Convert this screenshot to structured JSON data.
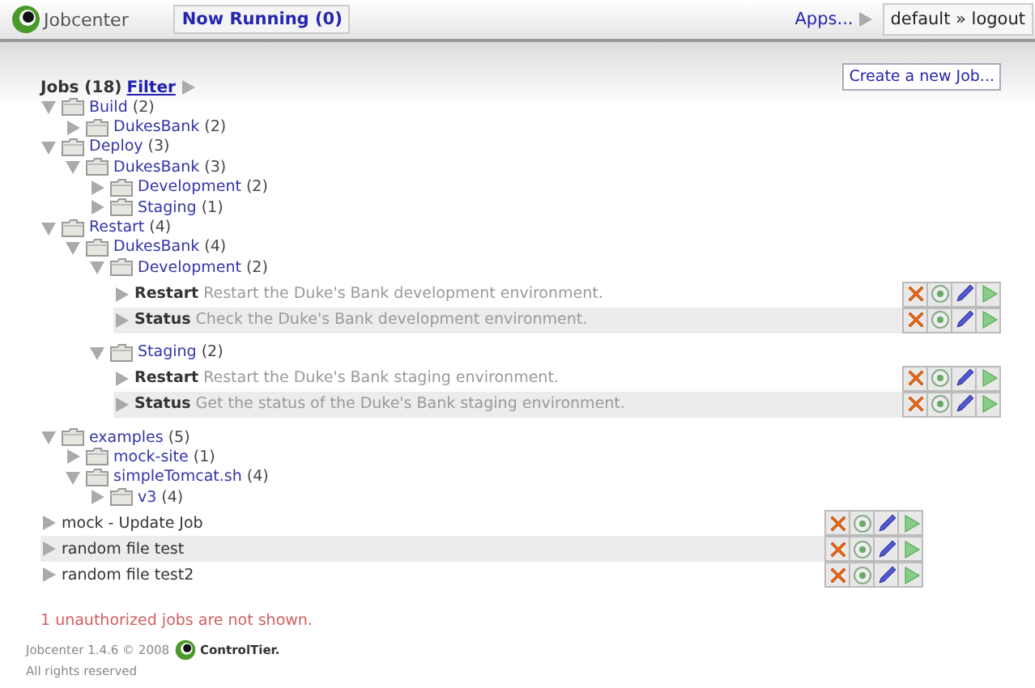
{
  "header": {
    "app_name": "Jobcenter",
    "now_running": "Now Running (0)",
    "apps_link": "Apps...",
    "user_menu": "default » logout"
  },
  "jobs_panel": {
    "title": "Jobs (18)",
    "filter_link": "Filter",
    "create_button": "Create a new Job...",
    "tree": [
      {
        "kind": "folder",
        "name": "Build",
        "count": "(2)",
        "expanded": true,
        "children": [
          {
            "kind": "folder",
            "name": "DukesBank",
            "count": "(2)",
            "expanded": false
          }
        ]
      },
      {
        "kind": "folder",
        "name": "Deploy",
        "count": "(3)",
        "expanded": true,
        "children": [
          {
            "kind": "folder",
            "name": "DukesBank",
            "count": "(3)",
            "expanded": true,
            "children": [
              {
                "kind": "folder",
                "name": "Development",
                "count": "(2)",
                "expanded": false
              },
              {
                "kind": "folder",
                "name": "Staging",
                "count": "(1)",
                "expanded": false
              }
            ]
          }
        ]
      },
      {
        "kind": "folder",
        "name": "Restart",
        "count": "(4)",
        "expanded": true,
        "children": [
          {
            "kind": "folder",
            "name": "DukesBank",
            "count": "(4)",
            "expanded": true,
            "children": [
              {
                "kind": "folder",
                "name": "Development",
                "count": "(2)",
                "expanded": true,
                "children": [
                  {
                    "kind": "job",
                    "name": "Restart",
                    "description": "Restart the Duke's Bank development environment."
                  },
                  {
                    "kind": "job",
                    "name": "Status",
                    "description": "Check the Duke's Bank development environment."
                  }
                ]
              },
              {
                "kind": "folder",
                "name": "Staging",
                "count": "(2)",
                "expanded": true,
                "children": [
                  {
                    "kind": "job",
                    "name": "Restart",
                    "description": "Restart the Duke's Bank staging environment."
                  },
                  {
                    "kind": "job",
                    "name": "Status",
                    "description": "Get the status of the Duke's Bank staging environment."
                  }
                ]
              }
            ]
          }
        ]
      },
      {
        "kind": "folder",
        "name": "examples",
        "count": "(5)",
        "expanded": true,
        "children": [
          {
            "kind": "folder",
            "name": "mock-site",
            "count": "(1)",
            "expanded": false
          },
          {
            "kind": "folder",
            "name": "simpleTomcat.sh",
            "count": "(4)",
            "expanded": true,
            "children": [
              {
                "kind": "folder",
                "name": "v3",
                "count": "(4)",
                "expanded": false
              }
            ]
          }
        ]
      },
      {
        "kind": "job",
        "name": "mock - Update Job"
      },
      {
        "kind": "job",
        "name": "random file test"
      },
      {
        "kind": "job",
        "name": "random file test2"
      }
    ],
    "notice": "1 unauthorized jobs are not shown."
  },
  "footer": {
    "version": "Jobcenter 1.4.6 © 2008",
    "company": "ControlTier.",
    "rights": "All rights reserved"
  }
}
